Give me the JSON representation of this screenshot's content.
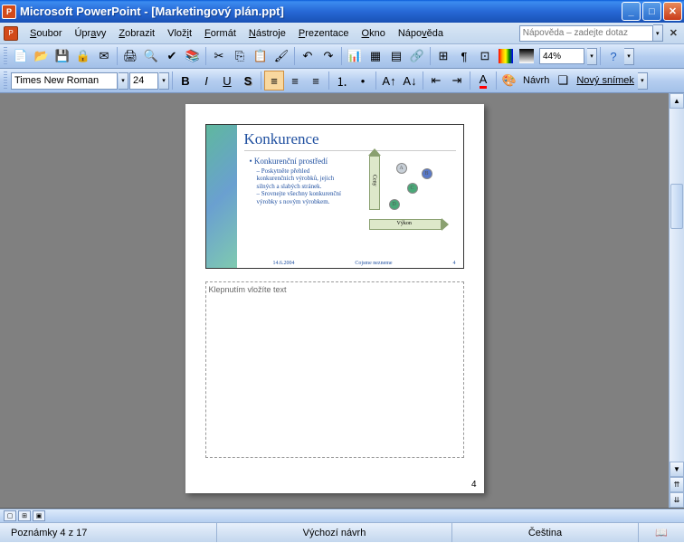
{
  "titlebar": {
    "app": "Microsoft PowerPoint",
    "doc": "[Marketingový plán.ppt]"
  },
  "menu": {
    "soubor": "Soubor",
    "upravy": "Úpravy",
    "zobrazit": "Zobrazit",
    "vlozit": "Vložit",
    "format": "Formát",
    "nastroje": "Nástroje",
    "prezentace": "Prezentace",
    "okno": "Okno",
    "napoveda": "Nápověda",
    "helpPlaceholder": "Nápověda – zadejte dotaz"
  },
  "toolbar": {
    "zoom": "44%"
  },
  "format": {
    "font": "Times New Roman",
    "size": "24",
    "navrh": "Návrh",
    "novy": "Nový snímek"
  },
  "slide": {
    "title": "Konkurence",
    "b1": "Konkurenční prostředí",
    "b2a": "Poskytněte přehled konkurenčních výrobků, jejich silných a slabých stránek.",
    "b2b": "Srovnejte všechny konkurenční výrobky s novým výrobkem.",
    "axisY": "Ceny",
    "axisX": "Výkon",
    "dotA": "A",
    "dotB": "B",
    "dotC": "C",
    "dotD": "D",
    "date": "14.6.2004",
    "company": "Cojsme nezneme",
    "num": "4"
  },
  "notes": {
    "placeholder": "Klepnutím vložíte text"
  },
  "page": {
    "num": "4"
  },
  "status": {
    "slide": "Poznámky 4 z 17",
    "design": "Výchozí návrh",
    "lang": "Čeština"
  }
}
